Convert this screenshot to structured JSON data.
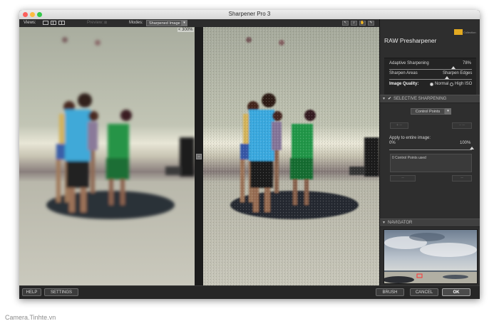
{
  "app": {
    "title": "Sharpener Pro 3"
  },
  "toolbar": {
    "views_label": "Views:",
    "preview_label": "Preview:",
    "modes_label": "Modes:",
    "mode_value": "Sharpened Image"
  },
  "viewer": {
    "zoom": "300%"
  },
  "panel": {
    "title": "RAW Presharpener",
    "logo_text": "Collection",
    "adaptive_label": "Adaptive Sharpening",
    "adaptive_value": "78%",
    "adaptive_level": 0.78,
    "sharpen_areas_label": "Sharpen Areas",
    "sharpen_edges_label": "Sharpen Edges",
    "sharpen_level": 0.7,
    "image_quality_label": "Image Quality:",
    "quality_options": [
      "Normal",
      "High ISO"
    ],
    "quality_selected": "Normal",
    "selective_header": "SELECTIVE SHARPENING",
    "control_points_option": "Control Points",
    "apply_label": "Apply to entire image:",
    "apply_min": "0%",
    "apply_max": "100%",
    "apply_level": 1.0,
    "cp_count": "0 Control Points used",
    "navigator_header": "NAVIGATOR"
  },
  "buttons": {
    "help": "HELP",
    "settings": "SETTINGS",
    "brush": "BRUSH",
    "cancel": "CANCEL",
    "ok": "OK"
  },
  "watermark": "Camera.Tinhte.vn",
  "colors": {
    "window_bg": "#1d1d1d",
    "panel_bg": "#2e2e2e",
    "accent_logo": "#e3aa21",
    "close": "#fc605c",
    "minimize": "#fdbc40",
    "zoom": "#34c84a"
  },
  "icons": [
    "view-single-icon",
    "view-split-icon",
    "view-side-by-side-icon",
    "preview-icon",
    "zoom-tool-icon",
    "zoom-in-icon",
    "hand-tool-icon",
    "dropper-tool-icon",
    "check-icon",
    "collapse-arrow-icon",
    "dropdown-arrow-icon"
  ]
}
